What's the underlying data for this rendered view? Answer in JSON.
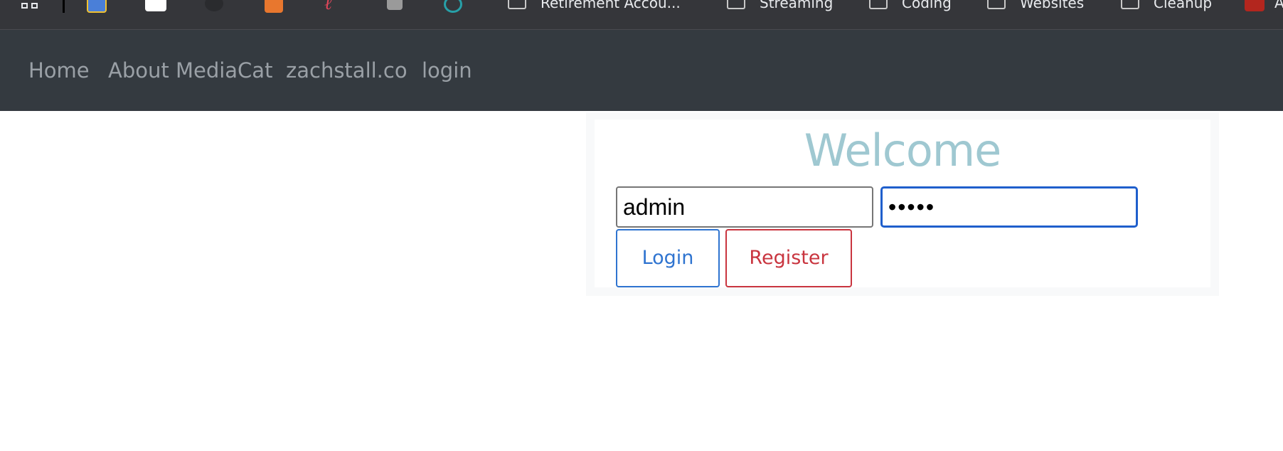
{
  "bookmarks_bar": {
    "folders": [
      {
        "label": "Retirement Accou..."
      },
      {
        "label": "Streaming"
      },
      {
        "label": "Coding"
      },
      {
        "label": "Websites"
      },
      {
        "label": "Cleanup"
      }
    ],
    "trailing_label": "A"
  },
  "navbar": {
    "links": [
      {
        "label": "Home"
      },
      {
        "label": "About MediaCat"
      },
      {
        "label": "zachstall.co"
      },
      {
        "label": "login"
      }
    ]
  },
  "login_panel": {
    "title": "Welcome",
    "username": {
      "value": "admin"
    },
    "password": {
      "value": "•••••"
    },
    "login_button": "Login",
    "register_button": "Register"
  },
  "colors": {
    "navbar_bg": "#343a40",
    "welcome_text": "#9fc8d1",
    "login_accent": "#2f74d0",
    "register_accent": "#c9353f",
    "focus_ring": "#1f5fcc"
  }
}
